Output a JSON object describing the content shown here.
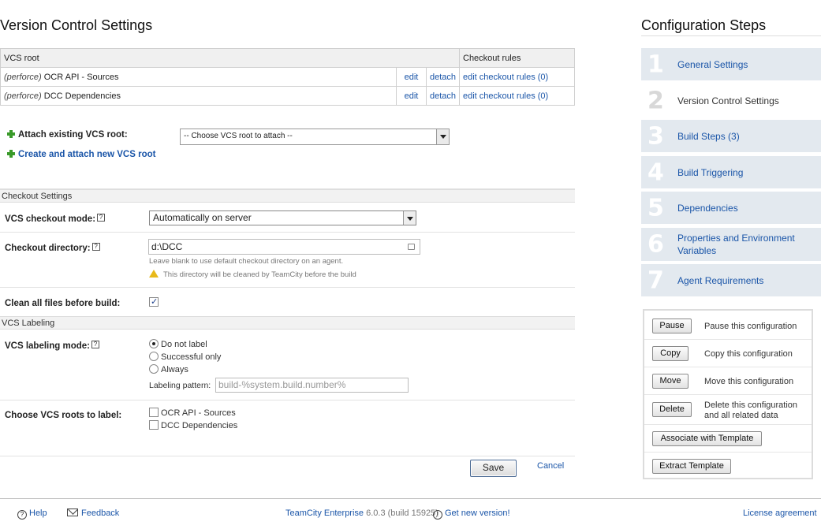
{
  "page": {
    "title": "Version Control Settings"
  },
  "vcs_table": {
    "headers": {
      "root": "VCS root",
      "rules": "Checkout rules"
    },
    "rows": [
      {
        "type": "(perforce)",
        "name": "OCR API - Sources",
        "edit": "edit",
        "detach": "detach",
        "rules": "edit checkout rules (0)"
      },
      {
        "type": "(perforce)",
        "name": "DCC Dependencies",
        "edit": "edit",
        "detach": "detach",
        "rules": "edit checkout rules (0)"
      }
    ]
  },
  "attach": {
    "label": "Attach existing VCS root:",
    "select_value": "-- Choose VCS root to attach --",
    "create_label": "Create and attach new VCS root"
  },
  "checkout": {
    "section_title": "Checkout Settings",
    "mode_label": "VCS checkout mode:",
    "mode_value": "Automatically on server",
    "dir_label": "Checkout directory:",
    "dir_value": "d:\\DCC",
    "dir_hint": "Leave blank to use default checkout directory on an agent.",
    "dir_warning": "This directory will be cleaned by TeamCity before the build",
    "clean_label": "Clean all files before build:",
    "clean_checked": true
  },
  "labeling": {
    "section_title": "VCS Labeling",
    "mode_label": "VCS labeling mode:",
    "options": [
      "Do not label",
      "Successful only",
      "Always"
    ],
    "selected_index": 0,
    "pattern_label": "Labeling pattern:",
    "pattern_value": "build-%system.build.number%",
    "roots_label": "Choose VCS roots to label:",
    "roots": [
      "OCR API - Sources",
      "DCC Dependencies"
    ]
  },
  "form": {
    "save_label": "Save",
    "cancel_label": "Cancel"
  },
  "steps": {
    "title": "Configuration Steps",
    "items": [
      {
        "num": "1",
        "label": "General Settings"
      },
      {
        "num": "2",
        "label": "Version Control Settings"
      },
      {
        "num": "3",
        "label": "Build Steps (3)"
      },
      {
        "num": "4",
        "label": "Build Triggering"
      },
      {
        "num": "5",
        "label": "Dependencies"
      },
      {
        "num": "6",
        "label": "Properties and Environment Variables"
      },
      {
        "num": "7",
        "label": "Agent Requirements"
      }
    ],
    "current_index": 1
  },
  "actions": {
    "pause": {
      "button": "Pause",
      "desc": "Pause this configuration"
    },
    "copy": {
      "button": "Copy",
      "desc": "Copy this configuration"
    },
    "move": {
      "button": "Move",
      "desc": "Move this configuration"
    },
    "delete": {
      "button": "Delete",
      "desc": "Delete this configuration and all related data"
    },
    "associate": {
      "button": "Associate with Template"
    },
    "extract": {
      "button": "Extract Template"
    }
  },
  "footer": {
    "help": "Help",
    "feedback": "Feedback",
    "product": "TeamCity Enterprise",
    "version": "6.0.3 (build 15925)",
    "new_version": "Get new version!",
    "license": "License agreement"
  },
  "icons": {
    "add": "plus-icon",
    "help": "help-icon",
    "warning": "warning-icon",
    "feedback": "envelope-icon"
  },
  "colors": {
    "link": "#1a55a8",
    "step_bg": "#e3e9ef",
    "plus": "#3a9a2a",
    "warning": "#e8b91a"
  }
}
